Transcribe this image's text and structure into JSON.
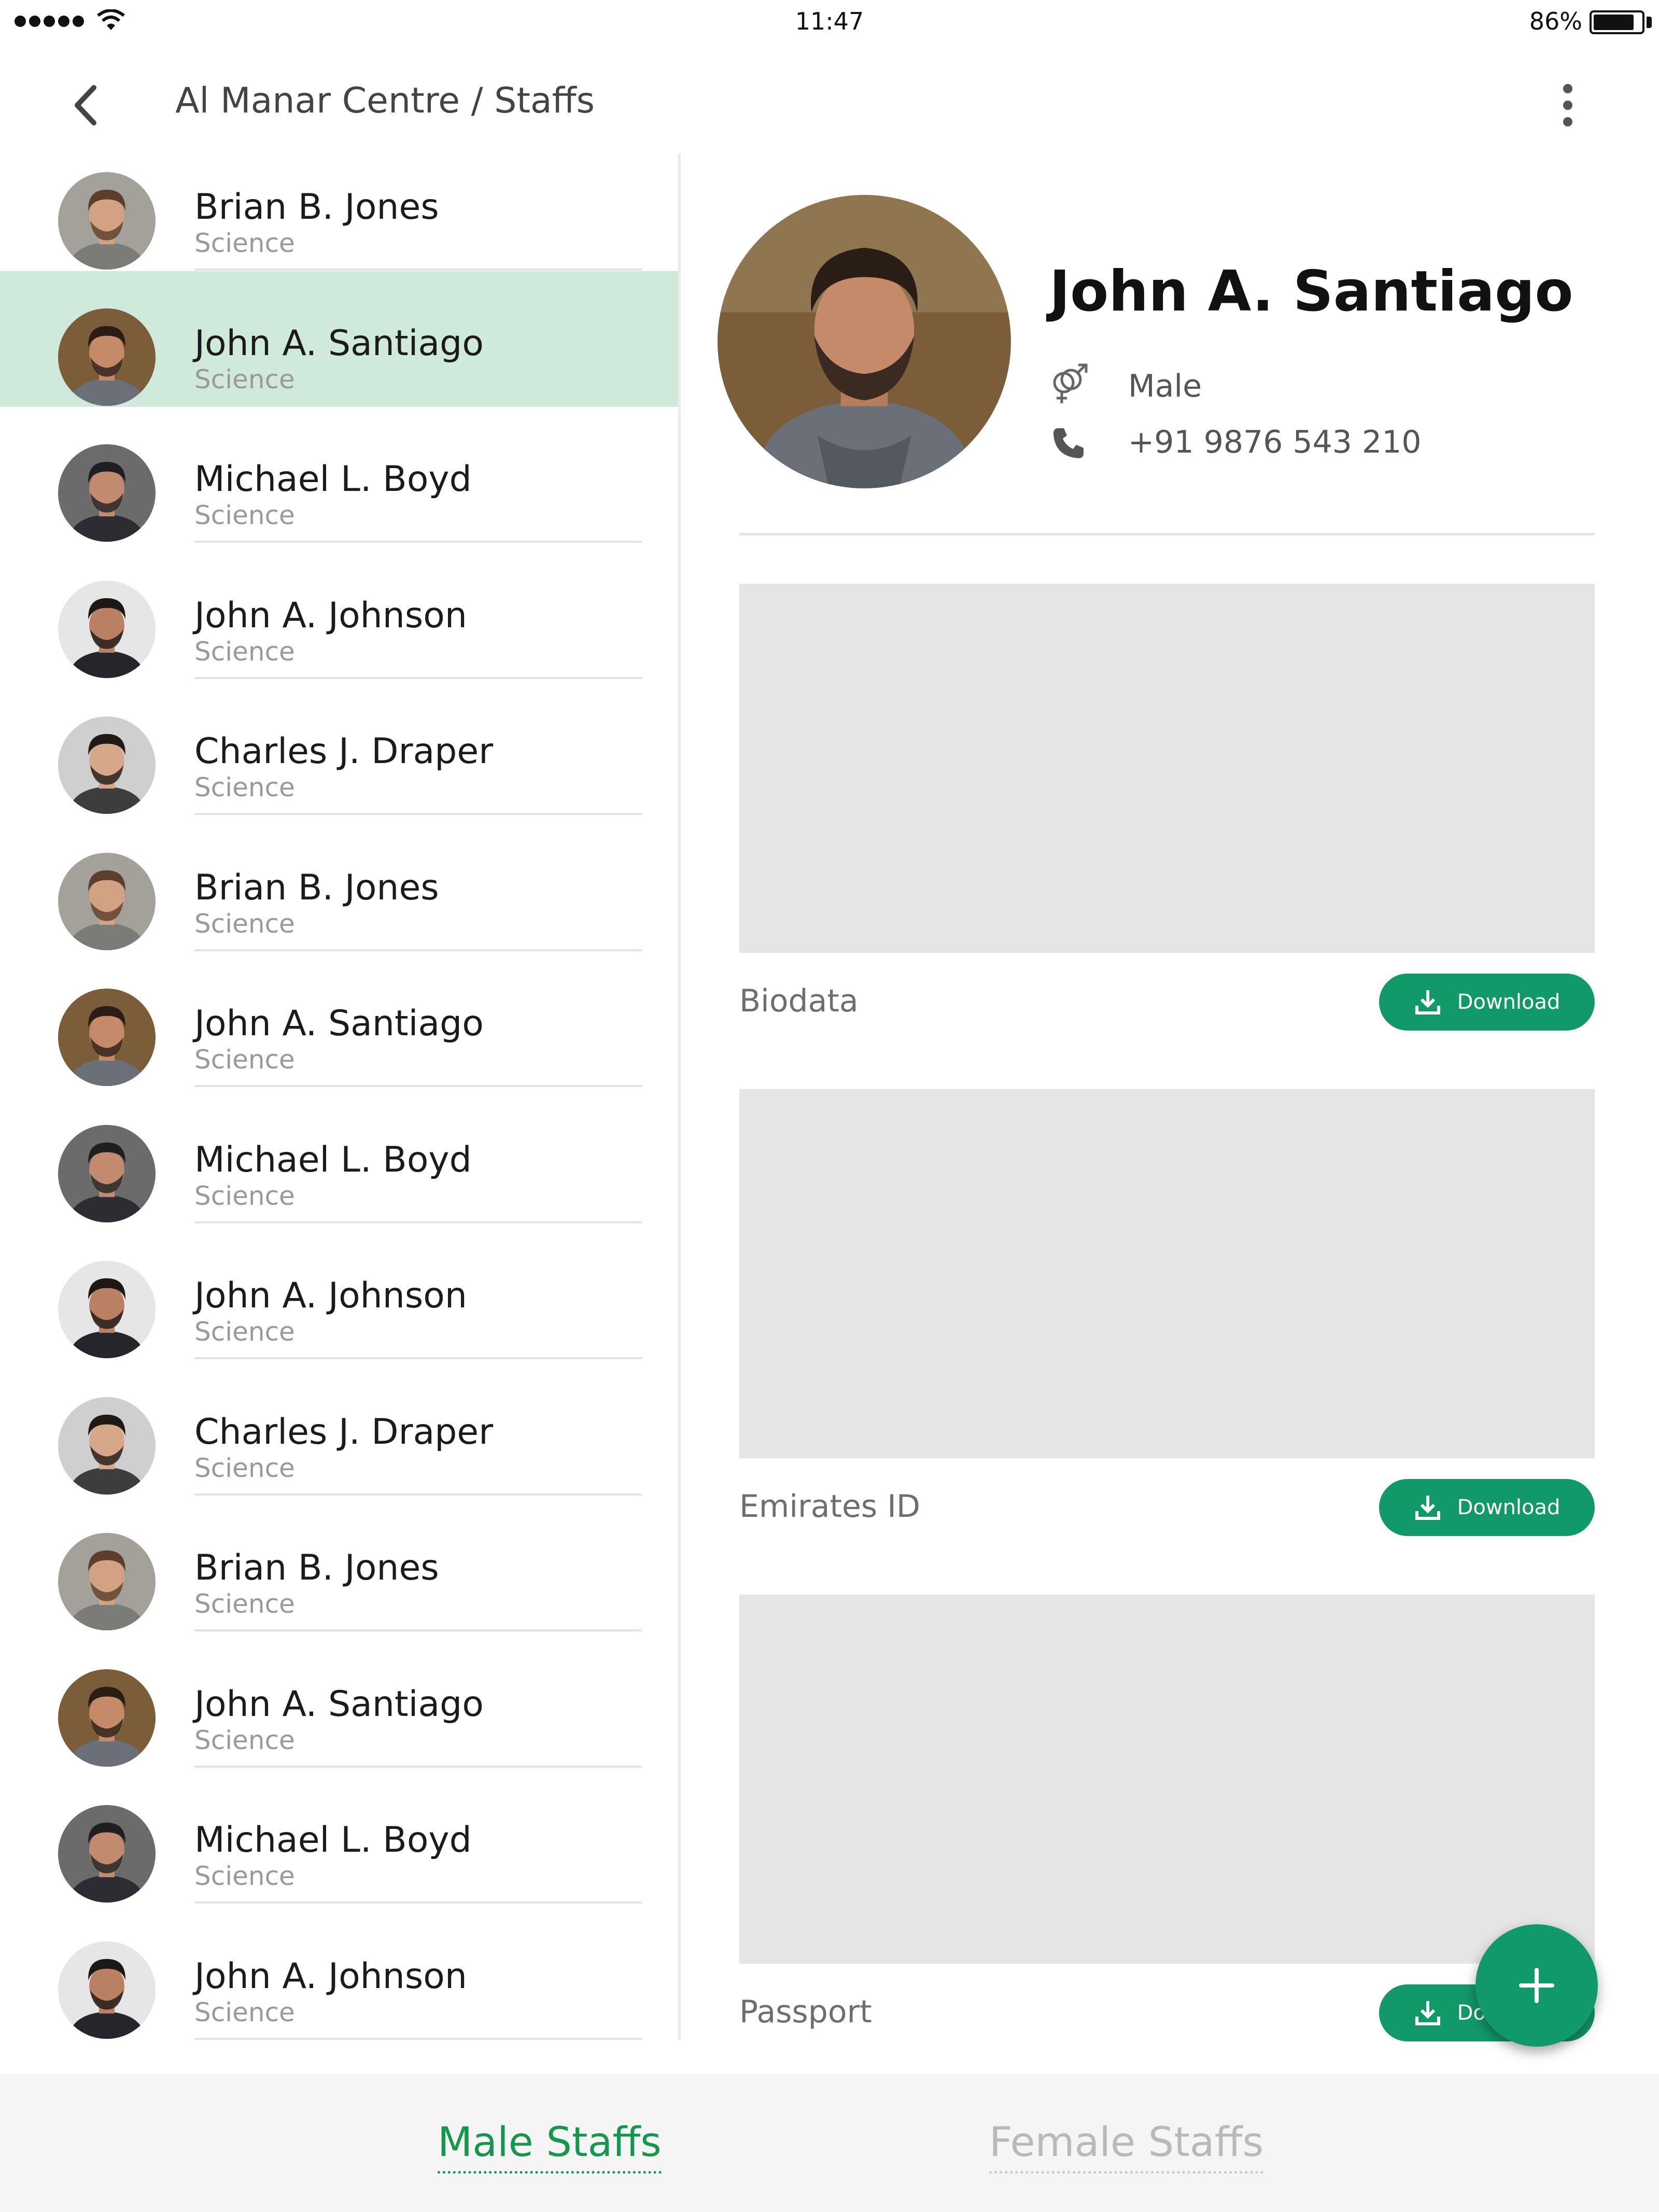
{
  "status_bar": {
    "time": "11:47",
    "battery": "86%",
    "battery_level": 0.86
  },
  "header": {
    "title": "Al Manar Centre / Staffs"
  },
  "staff_list": [
    {
      "name": "Brian B. Jones",
      "department": "Science",
      "selected": false,
      "avatar": {
        "bg": "#a4a19a",
        "skin": "#d2a283",
        "hair": "#5b3f2c",
        "shirt": "#7b7b78"
      }
    },
    {
      "name": "John A. Santiago",
      "department": "Science",
      "selected": true,
      "avatar": {
        "bg": "#7b5d3a",
        "skin": "#c48a6a",
        "hair": "#2a1d16",
        "shirt": "#6a6f78"
      }
    },
    {
      "name": "Michael L. Boyd",
      "department": "Science",
      "selected": false,
      "avatar": {
        "bg": "#6c6b6b",
        "skin": "#c28a6e",
        "hair": "#1f1f22",
        "shirt": "#2b2d33"
      }
    },
    {
      "name": "John A. Johnson",
      "department": "Science",
      "selected": false,
      "avatar": {
        "bg": "#e6e6e6",
        "skin": "#b98064",
        "hair": "#1c1816",
        "shirt": "#24262b"
      }
    },
    {
      "name": "Charles J. Draper",
      "department": "Science",
      "selected": false,
      "avatar": {
        "bg": "#cfcfcf",
        "skin": "#d6a789",
        "hair": "#201a17",
        "shirt": "#3d3d3d"
      }
    },
    {
      "name": "Brian B. Jones",
      "department": "Science",
      "selected": false,
      "avatar": {
        "bg": "#a4a19a",
        "skin": "#d2a283",
        "hair": "#5b3f2c",
        "shirt": "#7b7b78"
      }
    },
    {
      "name": "John A. Santiago",
      "department": "Science",
      "selected": false,
      "avatar": {
        "bg": "#7b5d3a",
        "skin": "#c48a6a",
        "hair": "#2a1d16",
        "shirt": "#6a6f78"
      }
    },
    {
      "name": "Michael L. Boyd",
      "department": "Science",
      "selected": false,
      "avatar": {
        "bg": "#6c6b6b",
        "skin": "#c28a6e",
        "hair": "#1f1f22",
        "shirt": "#2b2d33"
      }
    },
    {
      "name": "John A. Johnson",
      "department": "Science",
      "selected": false,
      "avatar": {
        "bg": "#e6e6e6",
        "skin": "#b98064",
        "hair": "#1c1816",
        "shirt": "#24262b"
      }
    },
    {
      "name": "Charles J. Draper",
      "department": "Science",
      "selected": false,
      "avatar": {
        "bg": "#cfcfcf",
        "skin": "#d6a789",
        "hair": "#201a17",
        "shirt": "#3d3d3d"
      }
    },
    {
      "name": "Brian B. Jones",
      "department": "Science",
      "selected": false,
      "avatar": {
        "bg": "#a4a19a",
        "skin": "#d2a283",
        "hair": "#5b3f2c",
        "shirt": "#7b7b78"
      }
    },
    {
      "name": "John A. Santiago",
      "department": "Science",
      "selected": false,
      "avatar": {
        "bg": "#7b5d3a",
        "skin": "#c48a6a",
        "hair": "#2a1d16",
        "shirt": "#6a6f78"
      }
    },
    {
      "name": "Michael L. Boyd",
      "department": "Science",
      "selected": false,
      "avatar": {
        "bg": "#6c6b6b",
        "skin": "#c28a6e",
        "hair": "#1f1f22",
        "shirt": "#2b2d33"
      }
    },
    {
      "name": "John A. Johnson",
      "department": "Science",
      "selected": false,
      "avatar": {
        "bg": "#e6e6e6",
        "skin": "#b98064",
        "hair": "#1c1816",
        "shirt": "#24262b"
      }
    }
  ],
  "detail": {
    "name": "John A. Santiago",
    "gender_icon": "gender-icon",
    "gender": "Male",
    "phone_icon": "phone-icon",
    "phone": "+91 9876 543 210",
    "documents": [
      {
        "label": "Biodata",
        "button_label": "Download",
        "icon": "download-icon"
      },
      {
        "label": "Emirates ID",
        "button_label": "Download",
        "icon": "download-icon"
      },
      {
        "label": "Passport",
        "button_label": "Download",
        "icon": "download-icon"
      }
    ]
  },
  "fab": {
    "icon": "plus-icon"
  },
  "tabs": [
    {
      "label": "Male Staffs",
      "active": true
    },
    {
      "label": "Female Staffs",
      "active": false
    }
  ],
  "colors": {
    "accent": "#12996a",
    "selected_row": "#cfe9da",
    "active_tab": "#18964f",
    "placeholder": "#e5e5e5"
  }
}
